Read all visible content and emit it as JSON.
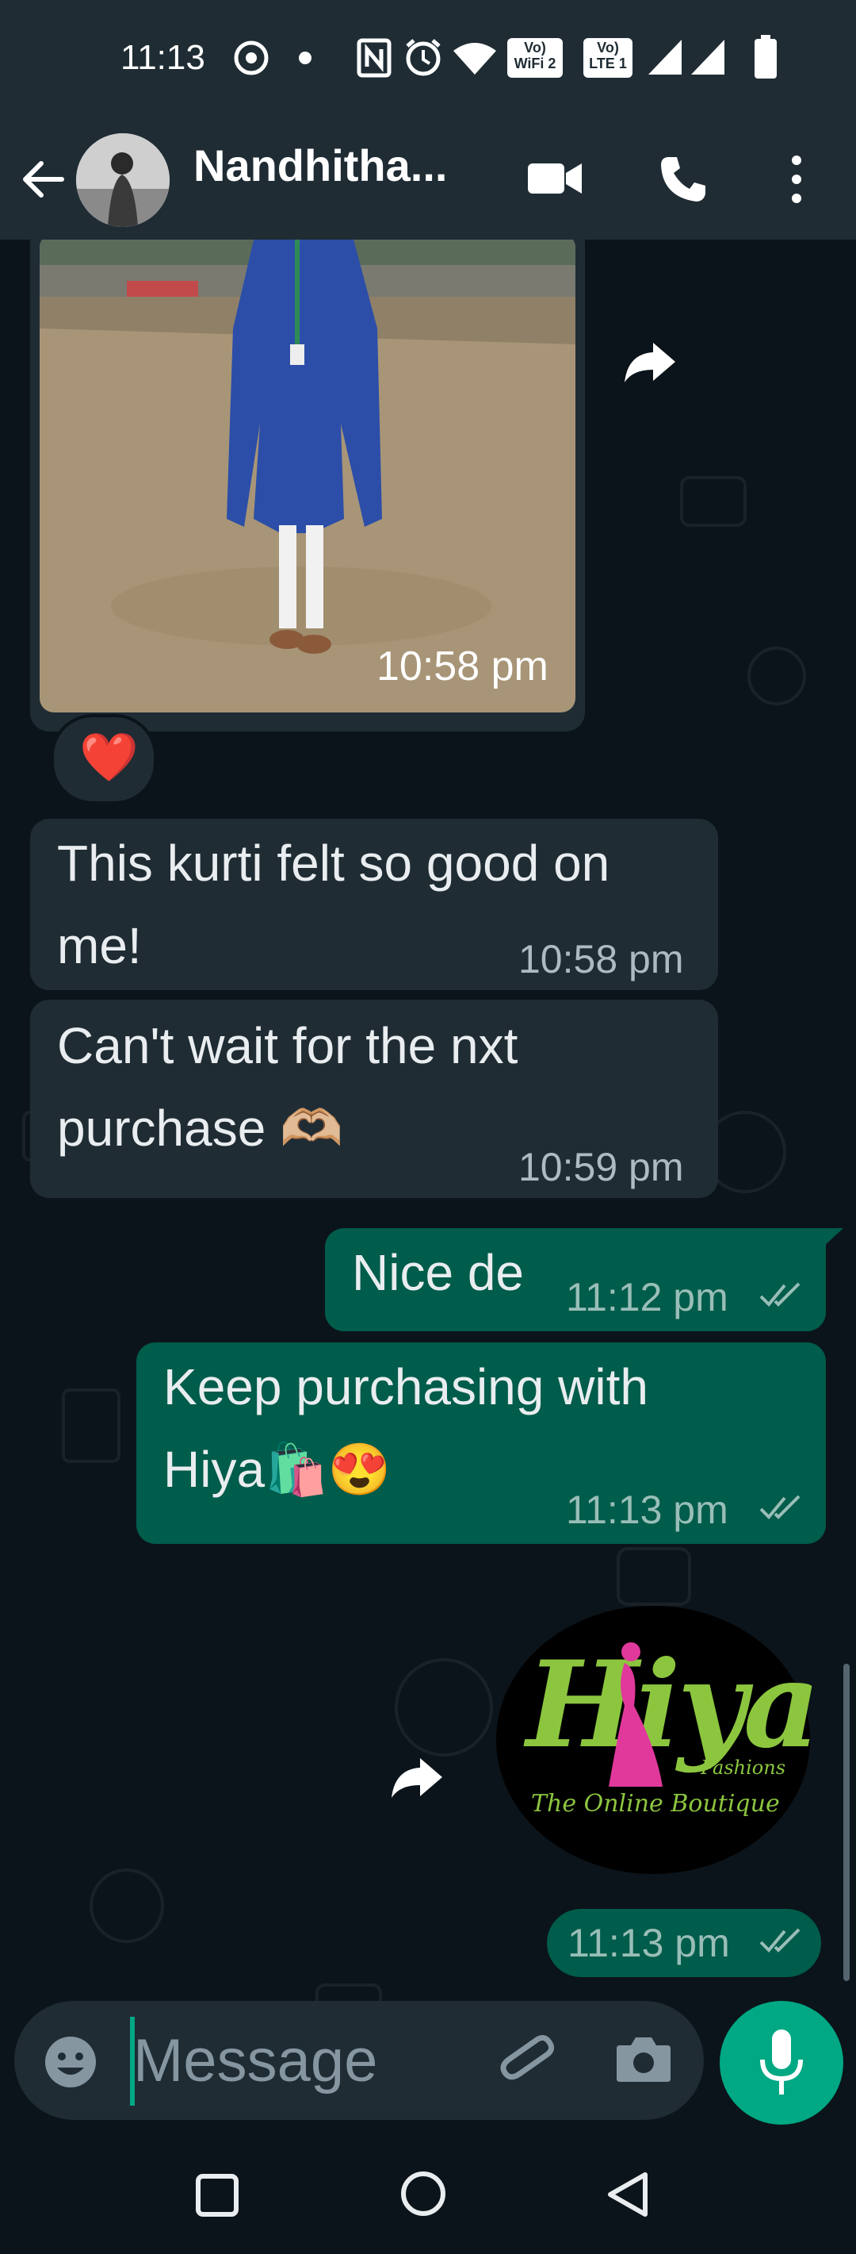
{
  "status_bar": {
    "time": "11:13",
    "indicators": [
      "whatsapp-status-icon",
      "dot-icon",
      "nfc-icon",
      "alarm-icon",
      "wifi-icon",
      "vowifi-icon",
      "volte-icon",
      "signal-icon",
      "signal-icon",
      "battery-icon"
    ],
    "vowifi_label": "Vo) WiFi 2",
    "volte_label": "Vo) LTE 1"
  },
  "app_bar": {
    "contact_name": "Nandhitha...",
    "icons": [
      "back-arrow-icon",
      "video-call-icon",
      "phone-call-icon",
      "more-vert-icon"
    ]
  },
  "messages": {
    "photo": {
      "time": "10:58 pm",
      "reaction": "❤️"
    },
    "m1": {
      "text": "This kurti felt so good on me!",
      "time": "10:58 pm"
    },
    "m2": {
      "text": "Can't wait for the nxt purchase 🫶🏼",
      "time": "10:59 pm"
    },
    "m3": {
      "text": "Nice de",
      "time": "11:12 pm"
    },
    "m4": {
      "text": "Keep purchasing with Hiya🛍️😍",
      "time": "11:13 pm"
    },
    "m5": {
      "logo_text": "Hiya",
      "logo_sub": "Fashions",
      "logo_tagline": "The Online Boutique",
      "time": "11:13 pm"
    }
  },
  "input_bar": {
    "placeholder": "Message"
  },
  "colors": {
    "header_bg": "#1f2c34",
    "chat_bg": "#0b141a",
    "incoming_bubble": "#1f2c34",
    "outgoing_bubble": "#005c4b",
    "accent": "#00a884",
    "logo_green": "#8cc63f",
    "logo_pink": "#e0399b"
  }
}
